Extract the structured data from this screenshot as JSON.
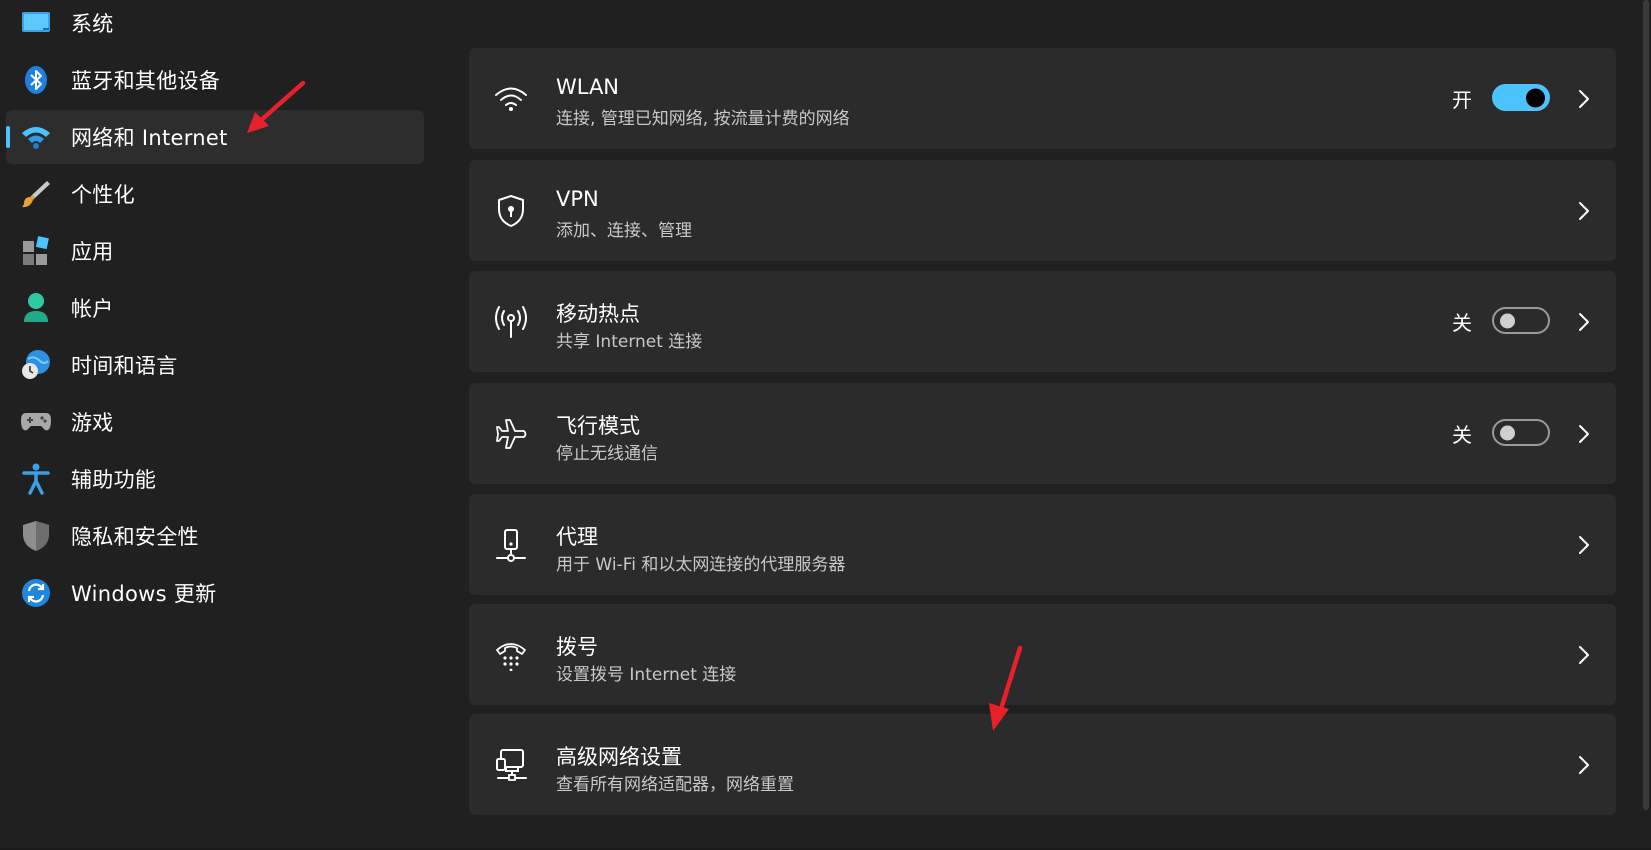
{
  "accent_color": "#4cc2ff",
  "annotation_color": "#e8202a",
  "sidebar": {
    "items": [
      {
        "label": "系统",
        "icon": "monitor-icon"
      },
      {
        "label": "蓝牙和其他设备",
        "icon": "bluetooth-icon"
      },
      {
        "label": "网络和 Internet",
        "icon": "wifi-icon",
        "selected": true
      },
      {
        "label": "个性化",
        "icon": "paintbrush-icon"
      },
      {
        "label": "应用",
        "icon": "apps-icon"
      },
      {
        "label": "帐户",
        "icon": "person-icon"
      },
      {
        "label": "时间和语言",
        "icon": "globe-clock-icon"
      },
      {
        "label": "游戏",
        "icon": "gamepad-icon"
      },
      {
        "label": "辅助功能",
        "icon": "accessibility-icon"
      },
      {
        "label": "隐私和安全性",
        "icon": "shield-icon"
      },
      {
        "label": "Windows 更新",
        "icon": "update-icon"
      }
    ]
  },
  "main": {
    "cards": [
      {
        "title": "WLAN",
        "subtitle": "连接, 管理已知网络, 按流量计费的网络",
        "icon": "wifi-icon",
        "toggle_label": "开",
        "toggle_on": true
      },
      {
        "title": "VPN",
        "subtitle": "添加、连接、管理",
        "icon": "vpn-shield-icon"
      },
      {
        "title": "移动热点",
        "subtitle": "共享 Internet 连接",
        "icon": "hotspot-icon",
        "toggle_label": "关",
        "toggle_on": false
      },
      {
        "title": "飞行模式",
        "subtitle": "停止无线通信",
        "icon": "airplane-icon",
        "toggle_label": "关",
        "toggle_on": false
      },
      {
        "title": "代理",
        "subtitle": "用于 Wi-Fi 和以太网连接的代理服务器",
        "icon": "proxy-icon"
      },
      {
        "title": "拨号",
        "subtitle": "设置拨号 Internet 连接",
        "icon": "dialup-icon"
      },
      {
        "title": "高级网络设置",
        "subtitle": "查看所有网络适配器，网络重置",
        "icon": "network-computer-icon"
      }
    ]
  }
}
